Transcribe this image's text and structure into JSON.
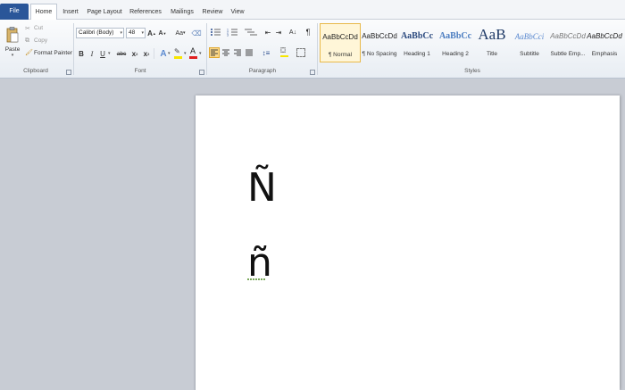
{
  "tabs": {
    "file": "File",
    "home": "Home",
    "insert": "Insert",
    "page_layout": "Page Layout",
    "references": "References",
    "mailings": "Mailings",
    "review": "Review",
    "view": "View"
  },
  "clipboard": {
    "paste": "Paste",
    "cut": "Cut",
    "copy": "Copy",
    "format_painter": "Format Painter",
    "label": "Clipboard"
  },
  "font": {
    "family": "Calibri (Body)",
    "size": "48",
    "grow": "A",
    "shrink": "A",
    "case": "Aa",
    "bold": "B",
    "italic": "I",
    "underline": "U",
    "strike": "abc",
    "subscript": "x",
    "superscript": "x",
    "color_a": "A",
    "label": "Font"
  },
  "paragraph": {
    "label": "Paragraph",
    "pilcrow": "¶"
  },
  "styles": {
    "label": "Styles",
    "items": [
      {
        "sample": "AaBbCcDd",
        "name": "¶ Normal"
      },
      {
        "sample": "AaBbCcDd",
        "name": "¶ No Spacing"
      },
      {
        "sample": "AaBbCc",
        "name": "Heading 1"
      },
      {
        "sample": "AaBbCc",
        "name": "Heading 2"
      },
      {
        "sample": "AaB",
        "name": "Title"
      },
      {
        "sample": "AaBbCci",
        "name": "Subtitle"
      },
      {
        "sample": "AaBbCcDd",
        "name": "Subtle Emp..."
      },
      {
        "sample": "AaBbCcDd",
        "name": "Emphasis"
      }
    ]
  },
  "document": {
    "line1": "Ñ",
    "line2": "ñ"
  },
  "colors": {
    "file_tab": "#2a5699",
    "font_color_bar": "#e02020",
    "highlight_bar": "#f7e600",
    "selected_style": "#e8b94a"
  }
}
